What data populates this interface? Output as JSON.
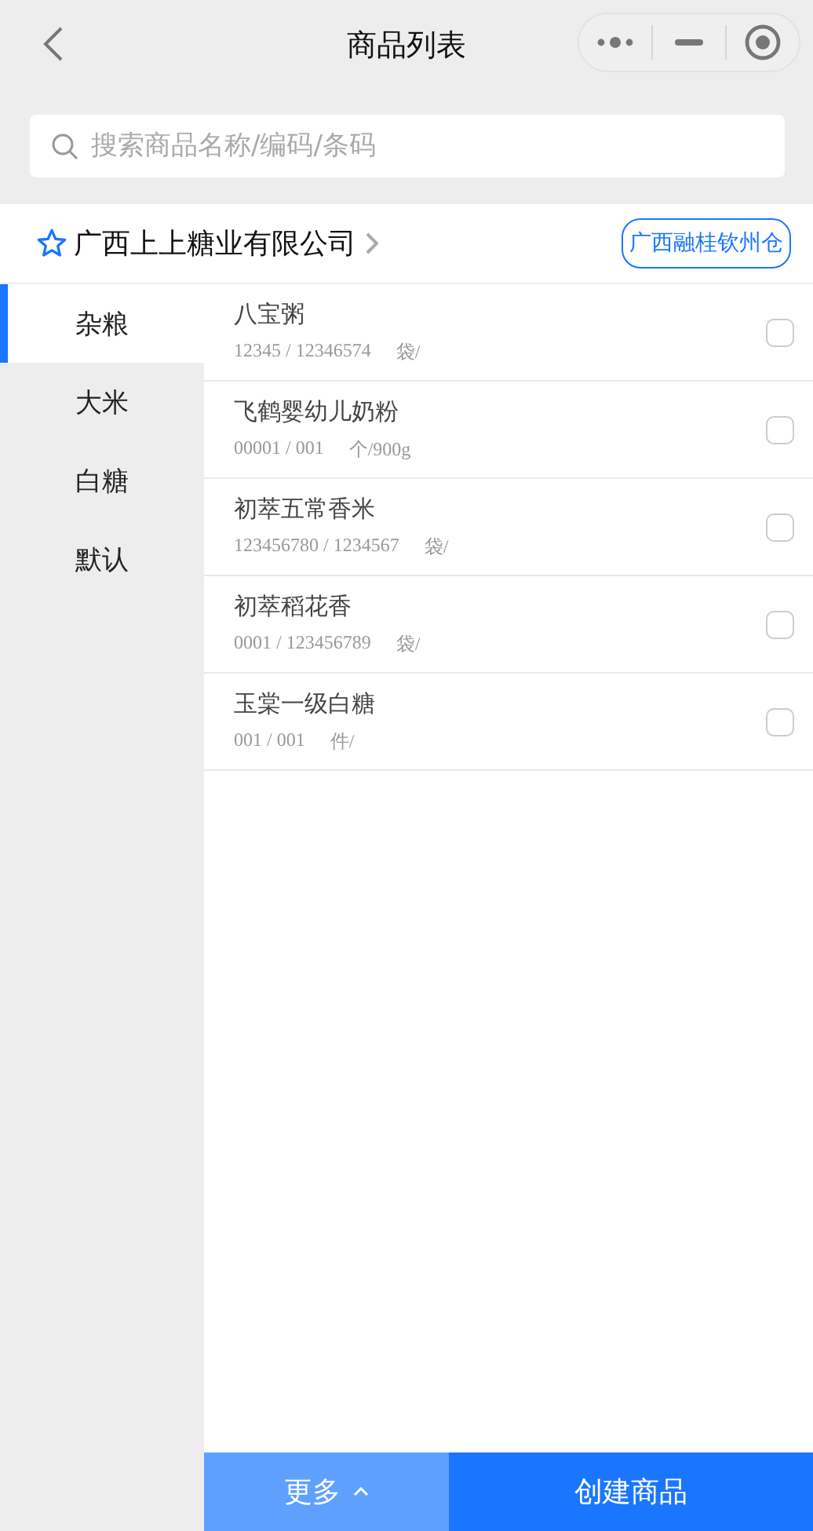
{
  "nav_bar": {
    "title": "商品列表"
  },
  "search": {
    "placeholder": "搜索商品名称/编码/条码"
  },
  "supplier": {
    "name": "广西上上糖业有限公司",
    "warehouse": "广西融桂钦州仓"
  },
  "categories": [
    {
      "label": "杂粮",
      "selected": true
    },
    {
      "label": "大米",
      "selected": false
    },
    {
      "label": "白糖",
      "selected": false
    },
    {
      "label": "默认",
      "selected": false
    }
  ],
  "products": [
    {
      "name": "八宝粥",
      "codes": "12345 / 12346574",
      "unit": "袋/",
      "checked": false
    },
    {
      "name": "飞鹤婴幼儿奶粉",
      "codes": "00001 / 001",
      "unit": "个/900g",
      "checked": false
    },
    {
      "name": "初萃五常香米",
      "codes": "123456780 / 1234567",
      "unit": "袋/",
      "checked": false
    },
    {
      "name": "初萃稻花香",
      "codes": "0001 / 123456789",
      "unit": "袋/",
      "checked": false
    },
    {
      "name": "玉棠一级白糖",
      "codes": "001 / 001",
      "unit": "件/",
      "checked": false
    }
  ],
  "footer": {
    "more": "更多",
    "create": "创建商品"
  }
}
